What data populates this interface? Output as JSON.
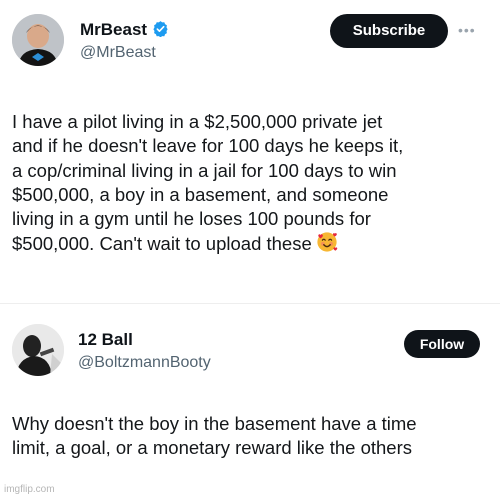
{
  "posts": [
    {
      "display_name": "MrBeast",
      "handle": "@MrBeast",
      "action_button": "Subscribe",
      "verified": true,
      "text": "I have a pilot living in a $2,500,000 private jet\nand if he doesn't leave for 100 days he keeps it,\na cop/criminal living in a jail for 100 days to win\n$500,000, a boy in a basement, and someone\nliving in a gym until he loses 100 pounds for\n$500,000. Can't wait to upload these",
      "emoji": "smiling-face-with-hearts"
    },
    {
      "display_name": "12 Ball",
      "handle": "@BoltzmannBooty",
      "action_button": "Follow",
      "text": "Why doesn't the boy in the basement have a time\nlimit, a goal, or a monetary reward like the others"
    }
  ],
  "watermark": "imgflip.com",
  "colors": {
    "button_bg": "#0f1419",
    "verified": "#1d9bf0",
    "handle": "#536471"
  }
}
